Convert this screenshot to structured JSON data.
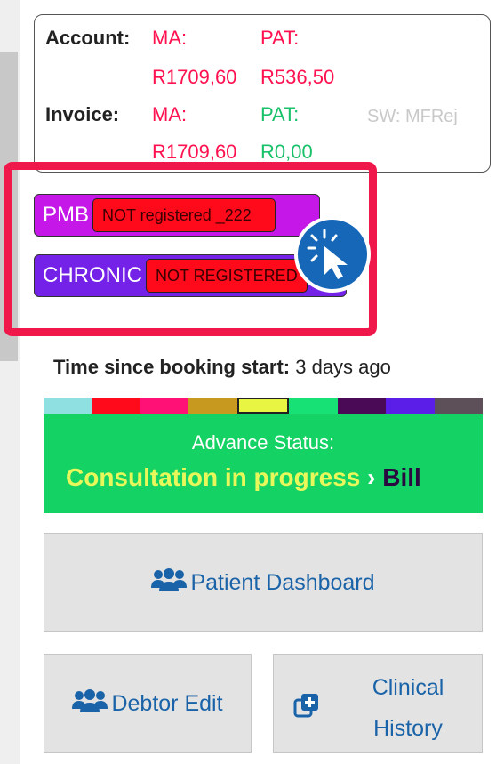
{
  "account": {
    "account_label": "Account:",
    "account_ma_label": "MA:",
    "account_ma_value": "R1709,60",
    "account_pat_label": "PAT:",
    "account_pat_value": "R536,50",
    "invoice_label": "Invoice:",
    "invoice_ma_label": "MA:",
    "invoice_ma_value": "R1709,60",
    "invoice_pat_label": "PAT:",
    "invoice_pat_value": "R0,00",
    "switch_status": "SW: MFRej"
  },
  "registrations": {
    "pmb_label": "PMB",
    "pmb_status": "NOT registered _222",
    "chronic_label": "CHRONIC",
    "chronic_status": "NOT REGISTERED"
  },
  "booking": {
    "time_label": "Time since booking start:",
    "time_value": "3 days ago"
  },
  "progress_colors": [
    "#8fe0e0",
    "#ff0a1a",
    "#ff1175",
    "#c79a1f",
    "#e8f542",
    "#17e074",
    "#4a0a55",
    "#5a1ee8",
    "#5e5058"
  ],
  "advance": {
    "title": "Advance Status:",
    "current": "Consultation in progress",
    "arrow": "›",
    "next": "Bill"
  },
  "buttons": {
    "patient_dashboard": "Patient Dashboard",
    "debtor_edit": "Debtor Edit",
    "clinical_history_line1": "Clinical",
    "clinical_history_line2": "History"
  },
  "icons": {
    "people": "users-icon",
    "clinical": "copy-plus-icon",
    "click": "pointer-click-icon"
  }
}
